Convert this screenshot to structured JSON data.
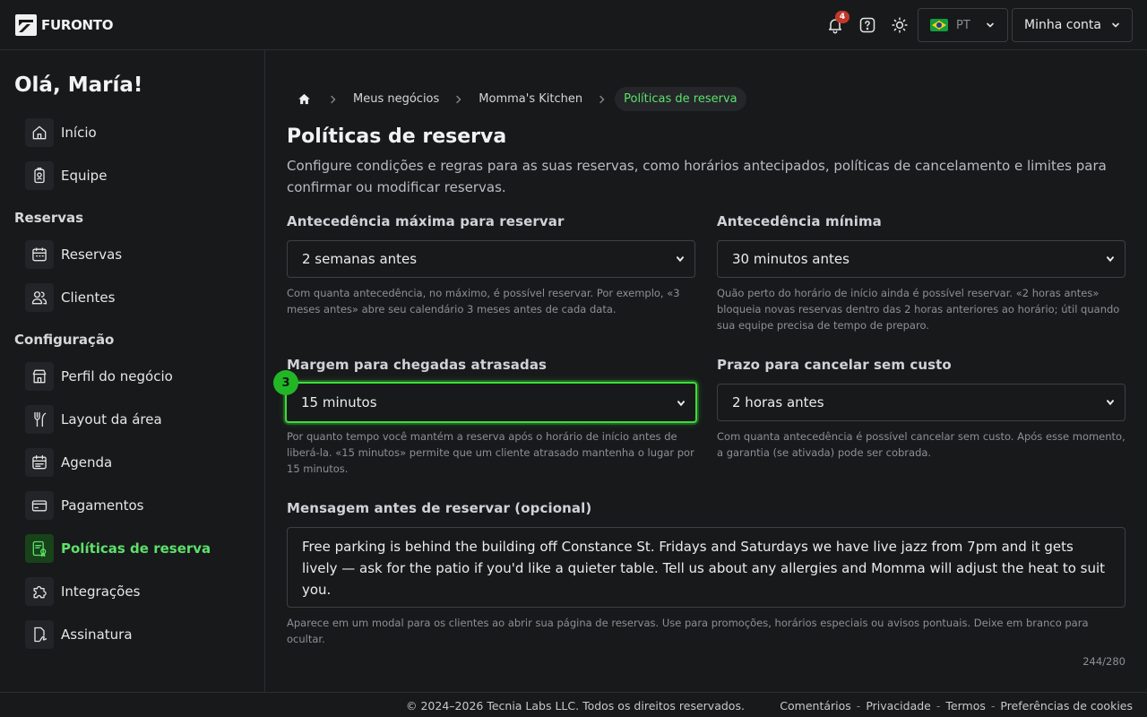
{
  "header": {
    "brand": "FURONTO",
    "notifications_count": "4",
    "language": {
      "label": "PT",
      "flag": "brazil-flag-icon"
    },
    "account_label": "Minha conta"
  },
  "sidebar": {
    "greeting": "Olá, María!",
    "top_items": [
      {
        "label": "Início",
        "icon": "home-icon"
      },
      {
        "label": "Equipe",
        "icon": "badge-icon"
      }
    ],
    "sections": [
      {
        "title": "Reservas",
        "items": [
          {
            "label": "Reservas",
            "icon": "calendar-icon"
          },
          {
            "label": "Clientes",
            "icon": "users-icon"
          }
        ]
      },
      {
        "title": "Configuração",
        "items": [
          {
            "label": "Perfil do negócio",
            "icon": "store-icon"
          },
          {
            "label": "Layout da área",
            "icon": "utensils-icon"
          },
          {
            "label": "Agenda",
            "icon": "schedule-icon"
          },
          {
            "label": "Pagamentos",
            "icon": "credit-card-icon"
          },
          {
            "label": "Políticas de reserva",
            "icon": "policy-icon",
            "active": true
          },
          {
            "label": "Integrações",
            "icon": "puzzle-icon"
          },
          {
            "label": "Assinatura",
            "icon": "signature-icon"
          }
        ]
      }
    ]
  },
  "breadcrumb": {
    "items": [
      "Meus negócios",
      "Momma's Kitchen"
    ],
    "current": "Políticas de reserva"
  },
  "page": {
    "title": "Políticas de reserva",
    "description": "Configure condições e regras para as suas reservas, como horários antecipados, políticas de cancelamento e limites para confirmar ou modificar reservas."
  },
  "fields": {
    "max_advance": {
      "label": "Antecedência máxima para reservar",
      "value": "2 semanas antes",
      "hint": "Com quanta antecedência, no máximo, é possível reservar. Por exemplo, «3 meses antes» abre seu calendário 3 meses antes de cada data."
    },
    "min_advance": {
      "label": "Antecedência mínima",
      "value": "30 minutos antes",
      "hint": "Quão perto do horário de início ainda é possível reservar. «2 horas antes» bloqueia novas reservas dentro das 2 horas anteriores ao horário; útil quando sua equipe precisa de tempo de preparo."
    },
    "late_margin": {
      "label": "Margem para chegadas atrasadas",
      "value": "15 minutos",
      "step": "3",
      "hint": "Por quanto tempo você mantém a reserva após o horário de início antes de liberá-la. «15 minutos» permite que um cliente atrasado mantenha o lugar por 15 minutos."
    },
    "cancel_deadline": {
      "label": "Prazo para cancelar sem custo",
      "value": "2 horas antes",
      "hint": "Com quanta antecedência é possível cancelar sem custo. Após esse momento, a garantia (se ativada) pode ser cobrada."
    },
    "message": {
      "label": "Mensagem antes de reservar (opcional)",
      "value": "Free parking is behind the building off Constance St. Fridays and Saturdays we have live jazz from 7pm and it gets lively — ask for the patio if you'd like a quieter table. Tell us about any allergies and Momma will adjust the heat to suit you.",
      "hint": "Aparece em um modal para os clientes ao abrir sua página de reservas. Use para promoções, horários especiais ou avisos pontuais. Deixe em branco para ocultar.",
      "counter": "244/280"
    }
  },
  "footer": {
    "copyright": "© 2024–2026 Tecnia Labs LLC. Todos os direitos reservados.",
    "links": [
      "Comentários",
      "Privacidade",
      "Termos",
      "Preferências de cookies"
    ]
  },
  "colors": {
    "accent": "#5de06a",
    "focus": "#3ddc3a",
    "badge": "#c0392b",
    "background": "#18191b"
  }
}
